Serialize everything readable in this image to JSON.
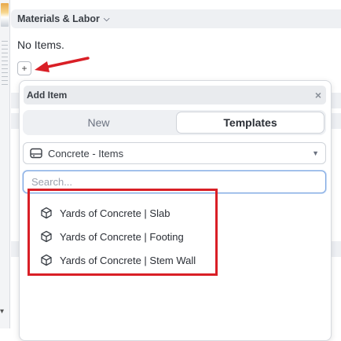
{
  "section": {
    "title": "Materials & Labor",
    "empty_text": "No Items.",
    "add_label": "+"
  },
  "popover": {
    "title": "Add Item",
    "close_label": "×",
    "tabs": [
      {
        "label": "New",
        "active": false
      },
      {
        "label": "Templates",
        "active": true
      }
    ],
    "category_select": {
      "value": "Concrete - Items",
      "icon": "drive-icon"
    },
    "search": {
      "placeholder": "Search...",
      "value": ""
    },
    "items": [
      {
        "label": "Yards of Concrete | Slab",
        "icon": "cube-icon"
      },
      {
        "label": "Yards of Concrete | Footing",
        "icon": "cube-icon"
      },
      {
        "label": "Yards of Concrete | Stem Wall",
        "icon": "cube-icon"
      }
    ]
  },
  "annotations": {
    "arrow_color": "#d91f26",
    "highlight_color": "#d91f26"
  }
}
